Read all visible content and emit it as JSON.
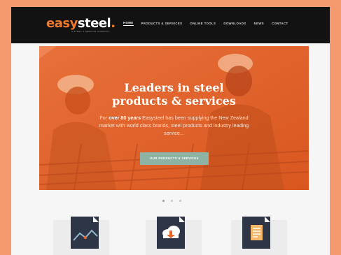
{
  "header": {
    "logo_easy": "easy",
    "logo_steel": "steel",
    "logo_mark": ".",
    "logo_tagline": "A STEEL & SERVICE COMPANY",
    "nav": [
      {
        "label": "HOME",
        "active": true
      },
      {
        "label": "PRODUCTS & SERVICES",
        "active": false
      },
      {
        "label": "ONLINE TOOLS",
        "active": false
      },
      {
        "label": "DOWNLOADS",
        "active": false
      },
      {
        "label": "NEWS",
        "active": false
      },
      {
        "label": "CONTACT",
        "active": false
      }
    ]
  },
  "hero": {
    "title_line1": "Leaders in steel",
    "title_line2": "products & services",
    "body_prefix": "For ",
    "body_bold": "over 80 years",
    "body_rest": " Easysteel has been supplying the New Zealand market with world class brands, steel products and industry leading service...",
    "button_label": "OUR PRODUCTS & SERVICES"
  },
  "carousel": {
    "slides": 3,
    "active_index": 0
  },
  "features": [
    {
      "icon": "chart-line-icon"
    },
    {
      "icon": "cloud-download-icon"
    },
    {
      "icon": "document-icon"
    }
  ],
  "colors": {
    "brand_orange": "#f07a2c",
    "hero_overlay": "#e6662a",
    "button": "#8eb3a4",
    "card": "#2e3547",
    "header_bg": "#121212"
  }
}
